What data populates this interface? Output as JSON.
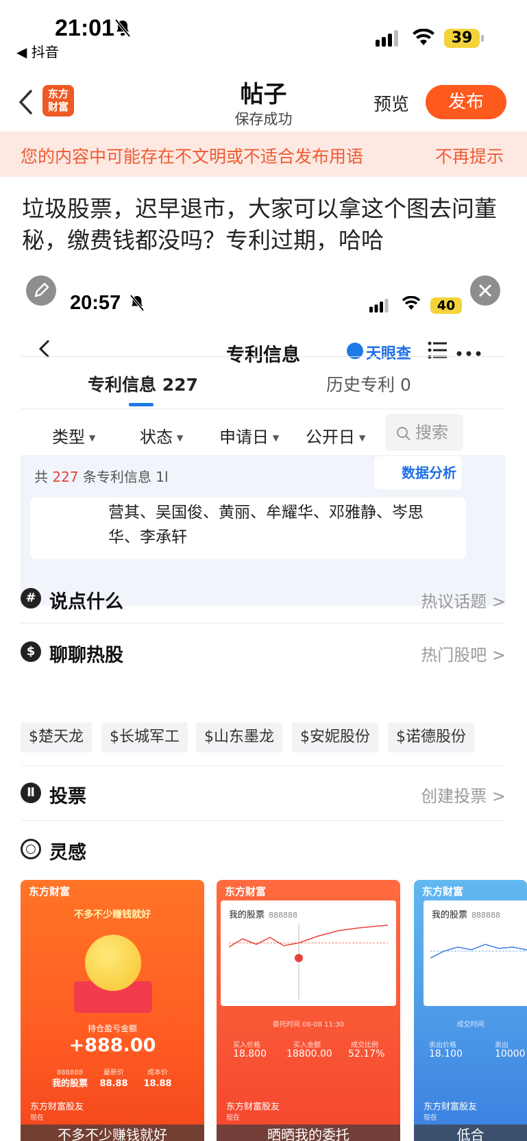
{
  "status_bar": {
    "time": "21:01",
    "back_app": "◀ 抖音",
    "battery": "39"
  },
  "header": {
    "title": "帖子",
    "subtitle": "保存成功",
    "preview": "预览",
    "publish": "发布",
    "logo": "东方\n财富"
  },
  "warning": {
    "text": "您的内容中可能存在不文明或不适合发布用语",
    "dismiss": "不再提示"
  },
  "post": {
    "text": "垃圾股票，迟早退市，大家可以拿这个图去问董秘，缴费钱都没吗？专利过期，哈哈"
  },
  "screenshot": {
    "time": "20:57",
    "battery": "40",
    "title": "专利信息",
    "brand": "天眼查",
    "tabs": [
      "专利信息 227",
      "历史专利 0"
    ],
    "filters": [
      "类型",
      "状态",
      "申请日",
      "公开日"
    ],
    "search": "搜索",
    "count_prefix": "共",
    "count": "227",
    "count_suffix": "条专利信息 1l",
    "analysis": "数据分析",
    "names": "营其、吴国俊、黄丽、牟耀华、邓雅静、岑思华、李承轩"
  },
  "options": [
    {
      "label": "说点什么",
      "right": "热议话题 >"
    },
    {
      "label": "聊聊热股",
      "right": "热门股吧 >"
    },
    {
      "label": "投票",
      "right": "创建投票 >"
    },
    {
      "label": "灵感",
      "right": ""
    }
  ],
  "tags": [
    "$楚天龙",
    "$长城军工",
    "$山东墨龙",
    "$安妮股份",
    "$诺德股份"
  ],
  "cards": [
    {
      "brand": "东方财富",
      "slogan": "不多不少赚钱就好",
      "label": "持仓盈亏金额",
      "amount": "+888.00",
      "stat_labels": [
        "888888",
        "最新价",
        "成本价"
      ],
      "stat_values": [
        "我的股票",
        "88.88",
        "18.88"
      ],
      "user": "东方财富股友",
      "now": "现在",
      "footer": "不多不少赚钱就好"
    },
    {
      "brand": "东方财富",
      "panel_title": "我的股票",
      "code": "888888",
      "meta": "委托时间  08-08 11:30",
      "metric_labels": [
        "买入价格",
        "买入金额",
        "成交比例"
      ],
      "metric_values": [
        "18.800",
        "18800.00",
        "52.17%"
      ],
      "user": "东方财富股友",
      "now": "现在",
      "footer": "晒晒我的委托"
    },
    {
      "brand": "东方财富",
      "panel_title": "我的股票",
      "code": "888888",
      "meta": "成交时间",
      "metric_labels": [
        "卖出价格",
        "卖出"
      ],
      "metric_values": [
        "18.100",
        "10000"
      ],
      "user": "东方财富股友",
      "now": "现在",
      "footer": "低合"
    }
  ],
  "colors": {
    "accent": "#ff5a1e",
    "warn_bg": "#fde9e2",
    "warn_text": "#ee5a33",
    "link_blue": "#1f7ae8"
  }
}
